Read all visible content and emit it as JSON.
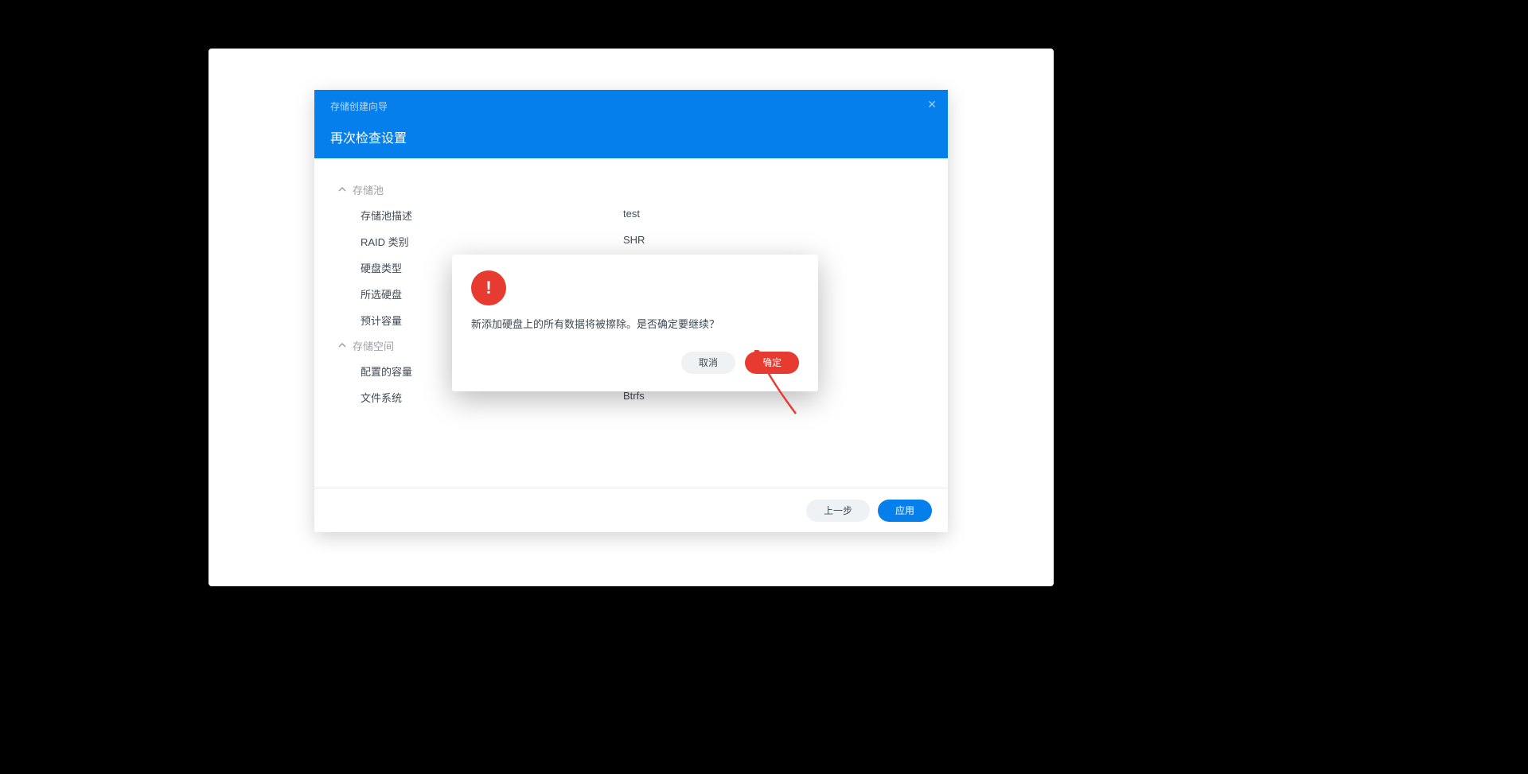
{
  "wizard": {
    "subtitle": "存储创建向导",
    "title": "再次检查设置",
    "section1_head": "存储池",
    "rows1": [
      {
        "label": "存储池描述",
        "value": "test"
      },
      {
        "label": "RAID 类别",
        "value": "SHR"
      },
      {
        "label": "硬盘类型",
        "value": ""
      },
      {
        "label": "所选硬盘",
        "value": ""
      },
      {
        "label": "预计容量",
        "value": ""
      }
    ],
    "section2_head": "存储空间",
    "rows2": [
      {
        "label": "配置的容量",
        "value": ""
      },
      {
        "label": "文件系统",
        "value": "Btrfs"
      }
    ],
    "footer_back": "上一步",
    "footer_apply": "应用"
  },
  "dialog": {
    "message": "新添加硬盘上的所有数据将被擦除。是否确定要继续？",
    "cancel": "取消",
    "ok": "确定"
  }
}
